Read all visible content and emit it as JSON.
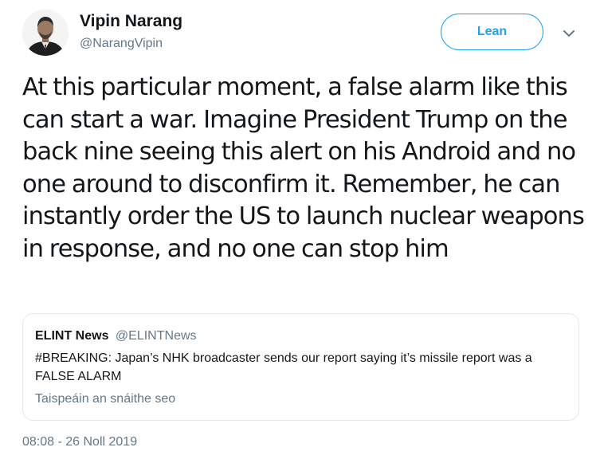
{
  "author": {
    "name": "Vipin Narang",
    "handle": "@NarangVipin"
  },
  "follow_button": {
    "label": "Lean"
  },
  "icons": {
    "menu": "chevron-down-icon",
    "avatar": "avatar"
  },
  "tweet": {
    "text": "At this particular moment, a false alarm like this can start a war. Imagine President Trump on the back nine seeing this alert on his Android and no one around to disconfirm it. Remember, he can instantly order the US to launch nuclear weapons in response, and no one can stop him"
  },
  "quote": {
    "name": "ELINT News",
    "handle": "@ELINTNews",
    "text": "#BREAKING: Japan’s NHK broadcaster sends our report saying it’s missile report was a FALSE ALARM",
    "show_thread": "Taispeáin an snáithe seo"
  },
  "timestamp": "08:08 - 26 Noll 2019",
  "colors": {
    "accent": "#1da1f2",
    "text": "#14171a",
    "muted": "#657786",
    "border": "#e1e8ed"
  }
}
